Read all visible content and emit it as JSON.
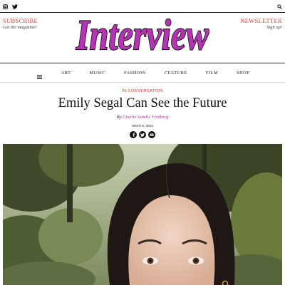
{
  "topbar": {
    "icons": [
      "instagram-icon",
      "twitter-icon",
      "search-icon"
    ]
  },
  "header": {
    "subscribe_label": "SUBSCRIBE",
    "subscribe_sub": "Get the magazine!",
    "logo_text": "Interview",
    "newsletter_label": "NEWSLETTER",
    "newsletter_sub": "Sign up!",
    "colors": {
      "accent_red": "#e0392a",
      "logo_purple": "#b832b8",
      "link_purple": "#c22fb8"
    }
  },
  "nav": {
    "menu_icon": "hamburger-icon",
    "items": [
      "ART",
      "MUSIC",
      "FASHION",
      "CULTURE",
      "FILM",
      "SHOP"
    ]
  },
  "article": {
    "category": "IN CONVERSATION",
    "title": "Emily Segal Can See the Future",
    "by_label": "By",
    "author": "Charlie-Janelle Fredberg",
    "date": "March 9, 2021",
    "share_icons": [
      "facebook-icon",
      "twitter-icon",
      "email-icon"
    ]
  }
}
